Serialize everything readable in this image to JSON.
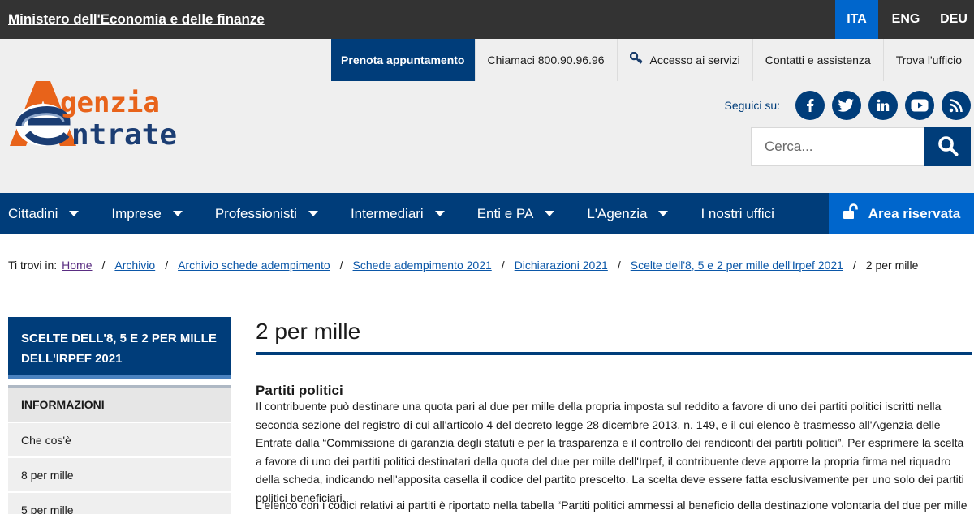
{
  "topbar": {
    "ministry": "Ministero dell'Economia e delle finanze",
    "languages": [
      {
        "label": "ITA",
        "active": true
      },
      {
        "label": "ENG",
        "active": false
      },
      {
        "label": "DEU",
        "active": false
      }
    ]
  },
  "utility": {
    "booking": "Prenota appuntamento",
    "phone": "Chiamaci 800.90.96.96",
    "services": "Accesso ai servizi",
    "contacts": "Contatti e assistenza",
    "office": "Trova l'ufficio"
  },
  "logo": {
    "line1": "genzia",
    "line2": "ntrate"
  },
  "social": {
    "label": "Seguici su:",
    "icons": [
      "facebook-icon",
      "twitter-icon",
      "linkedin-icon",
      "youtube-icon",
      "rss-icon"
    ]
  },
  "search": {
    "placeholder": "Cerca..."
  },
  "nav": {
    "items": [
      "Cittadini",
      "Imprese",
      "Professionisti",
      "Intermediari",
      "Enti e PA",
      "L'Agenzia",
      "I nostri uffici"
    ],
    "reserved": "Area riservata"
  },
  "breadcrumb": {
    "label": "Ti trovi in:",
    "items": [
      "Home",
      "Archivio",
      "Archivio schede adempimento",
      "Schede adempimento 2021",
      "Dichiarazioni 2021",
      "Scelte dell'8, 5 e 2 per mille dell'Irpef 2021"
    ],
    "current": "2 per mille"
  },
  "sidebar": {
    "title": "SCELTE DELL'8, 5 E 2 PER MILLE DELL'IRPEF 2021",
    "section": "INFORMAZIONI",
    "items": [
      "Che cos'è",
      "8 per mille",
      "5 per mille"
    ]
  },
  "content": {
    "title": "2 per mille",
    "heading": "Partiti politici",
    "paragraph1": "Il contribuente può destinare una quota pari al due per mille della propria imposta sul reddito a favore di uno dei partiti politici iscritti nella seconda sezione del registro di cui all'articolo 4 del decreto legge 28 dicembre 2013, n. 149, e il cui elenco è trasmesso all'Agenzia delle Entrate dalla “Commissione di garanzia degli statuti e per la trasparenza e il controllo dei rendiconti dei partiti politici”. Per esprimere la scelta a favore di uno dei partiti politici destinatari della quota del due per mille dell'Irpef, il contribuente deve apporre la propria firma nel riquadro della scheda, indicando nell'apposita casella il codice del partito prescelto. La scelta deve essere fatta esclusivamente per uno solo dei partiti politici beneficiari.",
    "paragraph2": "L'elenco con i codici relativi ai partiti è riportato nella tabella “Partiti politici ammessi al beneficio della destinazione volontaria del due per mille"
  },
  "colors": {
    "brand_blue": "#003d7a",
    "accent_blue": "#0066cc",
    "logo_orange": "#e8631a"
  }
}
